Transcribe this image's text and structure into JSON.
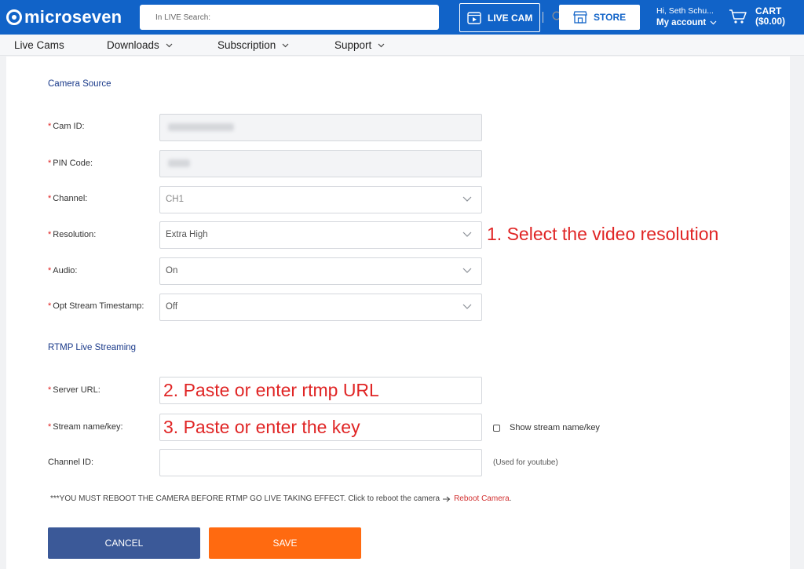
{
  "header": {
    "logo_text": "microseven",
    "search": {
      "placeholder": "In LIVE Search:"
    },
    "live_cam_label": "LIVE CAM",
    "store_label": "STORE",
    "account": {
      "greeting": "Hi, Seth Schu...",
      "label": "My account"
    },
    "cart": {
      "label": "CART",
      "amount": "($0.00)"
    }
  },
  "nav": {
    "items": [
      {
        "label": "Live Cams"
      },
      {
        "label": "Downloads"
      },
      {
        "label": "Subscription"
      },
      {
        "label": "Support"
      }
    ]
  },
  "form": {
    "camera_source_title": "Camera Source",
    "cam_id": {
      "label": "Cam ID:"
    },
    "pin_code": {
      "label": "PIN Code:"
    },
    "channel": {
      "label": "Channel:",
      "value": "CH1"
    },
    "resolution": {
      "label": "Resolution:",
      "value": "Extra High"
    },
    "audio": {
      "label": "Audio:",
      "value": "On"
    },
    "timestamp": {
      "label": "Opt Stream Timestamp:",
      "value": "Off"
    },
    "rtmp_title": "RTMP Live Streaming",
    "server_url": {
      "label": "Server URL:"
    },
    "stream_key": {
      "label": "Stream name/key:"
    },
    "show_stream_label": "Show stream name/key",
    "channel_id": {
      "label": "Channel ID:",
      "hint": "(Used for youtube)"
    },
    "required_mark": "*",
    "notice_text": "***YOU MUST REBOOT THE CAMERA BEFORE RTMP GO LIVE TAKING EFFECT. Click to reboot the camera",
    "reboot_link": "Reboot Camera",
    "notice_end": ".",
    "cancel_label": "CANCEL",
    "save_label": "SAVE"
  },
  "annotations": {
    "step1": "1. Select the video resolution",
    "step2": "2. Paste or enter rtmp URL",
    "step3": "3. Paste or enter the key"
  },
  "colors": {
    "header_bg": "#1163c8",
    "cancel_bg": "#3b5998",
    "save_bg": "#ff6a10",
    "annotation": "#e02525",
    "required": "#e02020"
  }
}
